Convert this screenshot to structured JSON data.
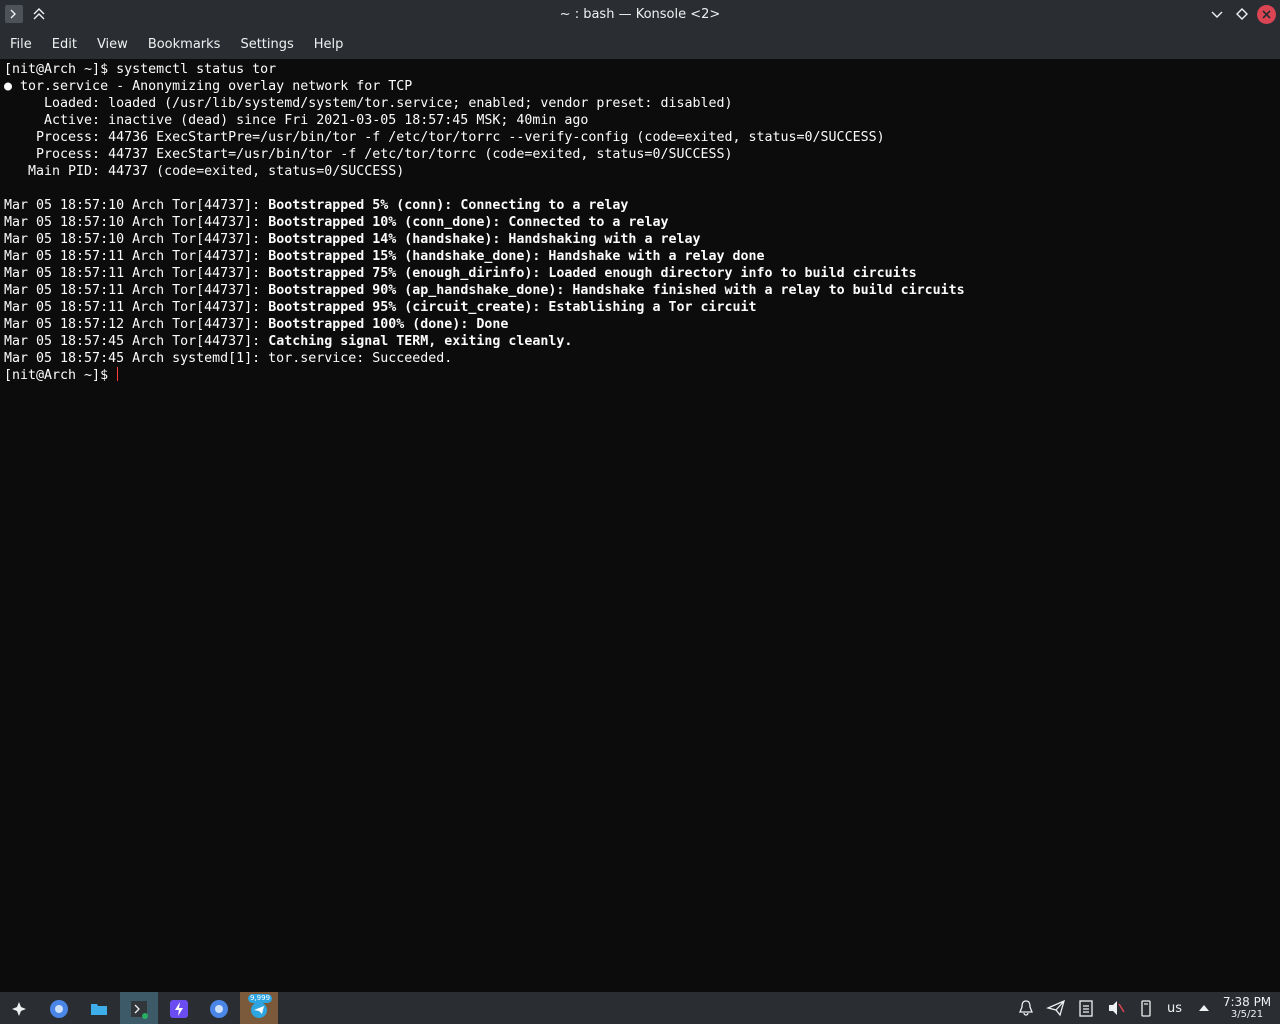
{
  "window": {
    "title": "~ : bash — Konsole <2>"
  },
  "menu": [
    "File",
    "Edit",
    "View",
    "Bookmarks",
    "Settings",
    "Help"
  ],
  "terminal": {
    "lines": [
      {
        "text": "[nit@Arch ~]$ systemctl status tor"
      },
      {
        "text": "● tor.service - Anonymizing overlay network for TCP"
      },
      {
        "text": "     Loaded: loaded (/usr/lib/systemd/system/tor.service; enabled; vendor preset: disabled)"
      },
      {
        "text": "     Active: inactive (dead) since Fri 2021-03-05 18:57:45 MSK; 40min ago"
      },
      {
        "text": "    Process: 44736 ExecStartPre=/usr/bin/tor -f /etc/tor/torrc --verify-config (code=exited, status=0/SUCCESS)"
      },
      {
        "text": "    Process: 44737 ExecStart=/usr/bin/tor -f /etc/tor/torrc (code=exited, status=0/SUCCESS)"
      },
      {
        "text": "   Main PID: 44737 (code=exited, status=0/SUCCESS)"
      },
      {
        "text": ""
      },
      {
        "prefix": "Mar 05 18:57:10 Arch Tor[44737]: ",
        "bold": "Bootstrapped 5% (conn): Connecting to a relay"
      },
      {
        "prefix": "Mar 05 18:57:10 Arch Tor[44737]: ",
        "bold": "Bootstrapped 10% (conn_done): Connected to a relay"
      },
      {
        "prefix": "Mar 05 18:57:10 Arch Tor[44737]: ",
        "bold": "Bootstrapped 14% (handshake): Handshaking with a relay"
      },
      {
        "prefix": "Mar 05 18:57:11 Arch Tor[44737]: ",
        "bold": "Bootstrapped 15% (handshake_done): Handshake with a relay done"
      },
      {
        "prefix": "Mar 05 18:57:11 Arch Tor[44737]: ",
        "bold": "Bootstrapped 75% (enough_dirinfo): Loaded enough directory info to build circuits"
      },
      {
        "prefix": "Mar 05 18:57:11 Arch Tor[44737]: ",
        "bold": "Bootstrapped 90% (ap_handshake_done): Handshake finished with a relay to build circuits"
      },
      {
        "prefix": "Mar 05 18:57:11 Arch Tor[44737]: ",
        "bold": "Bootstrapped 95% (circuit_create): Establishing a Tor circuit"
      },
      {
        "prefix": "Mar 05 18:57:12 Arch Tor[44737]: ",
        "bold": "Bootstrapped 100% (done): Done"
      },
      {
        "prefix": "Mar 05 18:57:45 Arch Tor[44737]: ",
        "bold": "Catching signal TERM, exiting cleanly."
      },
      {
        "text": "Mar 05 18:57:45 Arch systemd[1]: tor.service: Succeeded."
      },
      {
        "text": "[nit@Arch ~]$ ",
        "cursor": true
      }
    ]
  },
  "taskbar": {
    "apps": [
      {
        "icon": "app-launcher-icon"
      },
      {
        "icon": "chromium-icon"
      },
      {
        "icon": "file-manager-icon"
      },
      {
        "icon": "konsole-icon",
        "active": true
      },
      {
        "icon": "lightning-app-icon"
      },
      {
        "icon": "chromium-icon"
      },
      {
        "icon": "telegram-icon",
        "badge": "9,999"
      }
    ],
    "tray": [
      "notifications-icon",
      "send-icon",
      "clipboard-icon",
      "volume-muted-icon",
      "usb-icon"
    ],
    "keyboard_layout": "us",
    "clock": {
      "time": "7:38 PM",
      "date": "3/5/21"
    }
  },
  "colors": {
    "terminal_bg": "#0c0c0c",
    "terminal_fg": "#fcfcfc",
    "chrome_bg": "#2a2e32",
    "close_button": "#da4453",
    "cursor": "#ff3c3c",
    "active_task": "#3d5a68"
  }
}
